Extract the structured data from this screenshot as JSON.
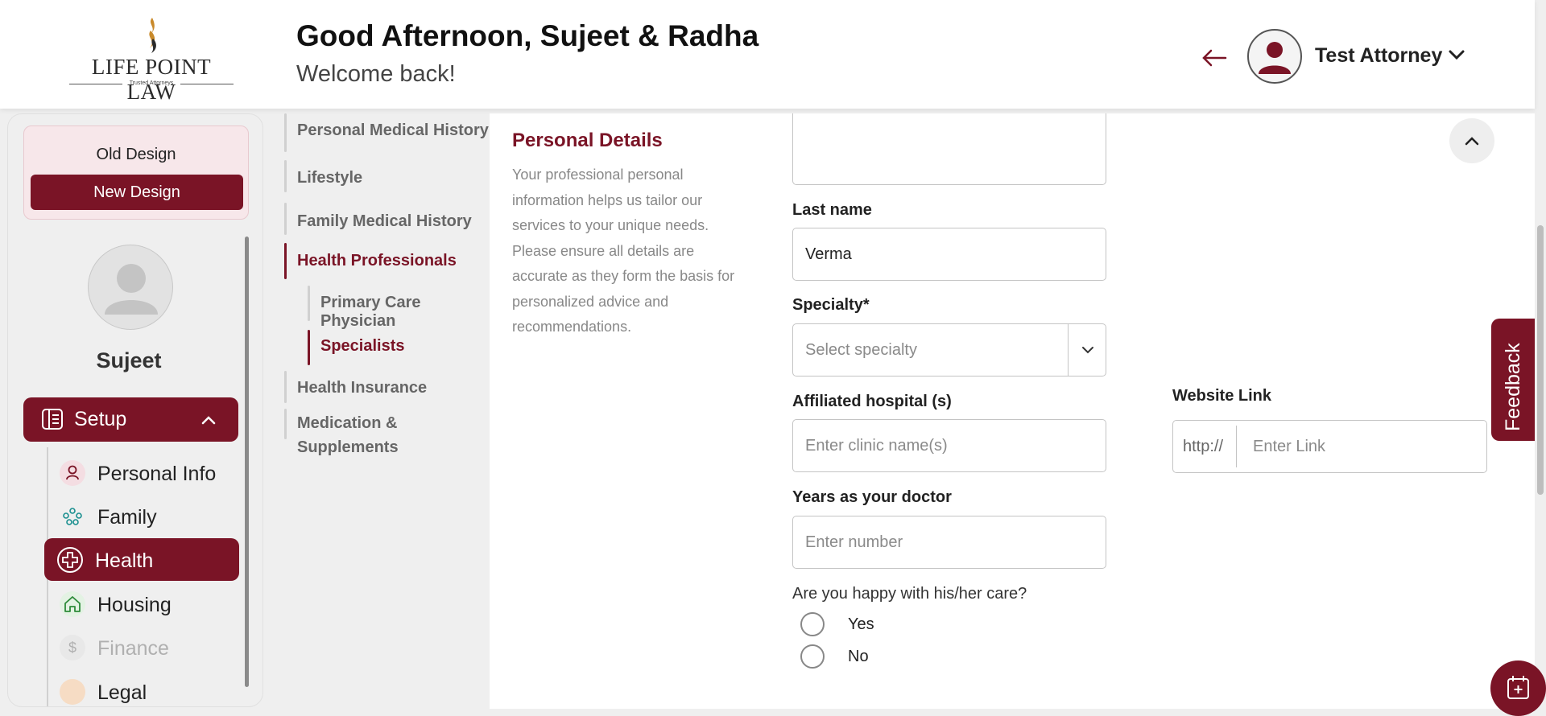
{
  "header": {
    "brand": "LIFE POINT LAW",
    "brand_tagline": "Trusted Attorneys",
    "greeting": "Good Afternoon, Sujeet & Radha",
    "welcome": "Welcome back!",
    "user_name": "Test Attorney"
  },
  "sidebar": {
    "old_design_label": "Old Design",
    "new_design_label": "New Design",
    "profile_name": "Sujeet",
    "setup_label": "Setup",
    "items": [
      {
        "label": "Personal Info",
        "icon": "person-icon",
        "state": "normal"
      },
      {
        "label": "Family",
        "icon": "family-icon",
        "state": "normal"
      },
      {
        "label": "Health",
        "icon": "medical-cross-icon",
        "state": "active"
      },
      {
        "label": "Housing",
        "icon": "home-icon",
        "state": "normal"
      },
      {
        "label": "Finance",
        "icon": "dollar-icon",
        "state": "disabled"
      },
      {
        "label": "Legal",
        "icon": "legal-icon",
        "state": "normal"
      }
    ]
  },
  "subnav": {
    "items": [
      {
        "label": "Personal Medical History"
      },
      {
        "label": "Lifestyle"
      },
      {
        "label": "Family Medical History"
      },
      {
        "label": "Health Professionals",
        "active": true
      },
      {
        "label": "Primary Care Physician",
        "nested": true
      },
      {
        "label": "Specialists",
        "nested": true,
        "active": true
      },
      {
        "label": "Health Insurance"
      },
      {
        "label": "Medication &"
      },
      {
        "label": "Supplements"
      }
    ]
  },
  "main": {
    "title": "Personal Details",
    "description": "Your professional personal information helps us tailor our services to your unique needs. Please ensure all details are accurate as they form the basis for personalized advice and recommendations.",
    "last_name_label": "Last name",
    "last_name_value": "Verma",
    "specialty_label": "Specialty*",
    "specialty_placeholder": "Select specialty",
    "hospital_label": "Affiliated hospital (s)",
    "hospital_placeholder": "Enter clinic name(s)",
    "years_label": "Years as your doctor",
    "years_placeholder": "Enter number",
    "website_label": "Website Link",
    "website_prefix": "http://",
    "website_placeholder": "Enter Link",
    "question": "Are you happy with his/her care?",
    "option_yes": "Yes",
    "option_no": "No"
  },
  "feedback_label": "Feedback",
  "colors": {
    "brand": "#7a1426",
    "background": "#efefef",
    "panel": "#ffffff"
  }
}
